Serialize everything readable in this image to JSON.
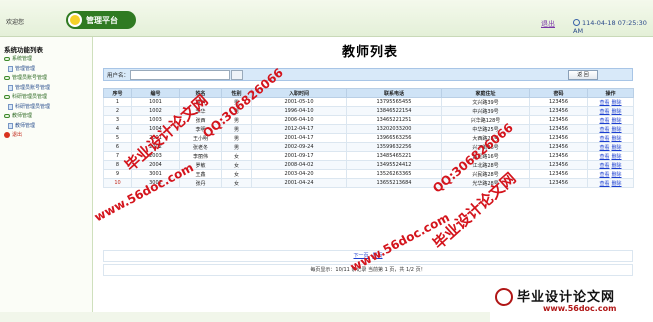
{
  "header": {
    "welcome": "欢迎您",
    "logo_text": "管理平台",
    "logout": "退出",
    "datetime": "114-04-18 07:25:30 AM"
  },
  "sidebar": {
    "title": "系统功能列表",
    "items": [
      {
        "label": "系统管理",
        "level": "top"
      },
      {
        "label": "管理管理",
        "level": "sub"
      },
      {
        "label": "管理员账号管理",
        "level": "top"
      },
      {
        "label": "管理员账号管理",
        "level": "sub"
      },
      {
        "label": "科研管理员管理",
        "level": "top"
      },
      {
        "label": "科研管理员管理",
        "level": "sub"
      },
      {
        "label": "教师管理",
        "level": "top"
      },
      {
        "label": "教师管理",
        "level": "sub"
      },
      {
        "label": "退出",
        "level": "exit"
      }
    ]
  },
  "main": {
    "title": "教师列表",
    "search_label": "用户名：",
    "search_value": "",
    "back_button": "返 回",
    "columns": [
      "序号",
      "编号",
      "姓名",
      "性别",
      "入职时间",
      "联系电话",
      "家庭住址",
      "密码",
      "操作"
    ],
    "rows": [
      [
        "1",
        "1001",
        "胡洪",
        "男",
        "2001-05-10",
        "13795565455",
        "文兴路39号",
        "123456"
      ],
      [
        "2",
        "1002",
        "李华",
        "男",
        "1996-04-10",
        "13846522154",
        "中兴路39号",
        "123456"
      ],
      [
        "3",
        "1003",
        "张西",
        "男",
        "2006-04-10",
        "13465221251",
        "兴华路128号",
        "123456"
      ],
      [
        "4",
        "1004",
        "李明",
        "男",
        "2012-04-17",
        "13202033200",
        "中华路25号",
        "123456"
      ],
      [
        "5",
        "2001",
        "王小明",
        "男",
        "2001-04-17",
        "13966563256",
        "大西路28号",
        "123456"
      ],
      [
        "6",
        "2002",
        "张老冬",
        "男",
        "2002-09-24",
        "13599632256",
        "兴丁街26号",
        "123456"
      ],
      [
        "7",
        "2003",
        "李丽伟",
        "女",
        "2001-09-17",
        "13485465221",
        "昌星路16号",
        "123456"
      ],
      [
        "8",
        "2004",
        "罗敏",
        "女",
        "2008-04-02",
        "13495524412",
        "江北路28号",
        "123456"
      ],
      [
        "9",
        "3001",
        "王鑫",
        "女",
        "2003-04-20",
        "13526263365",
        "兴民路28号",
        "123456"
      ],
      [
        "10",
        "3002",
        "张丹",
        "女",
        "2001-04-24",
        "13655213684",
        "光华路28号",
        "123456"
      ]
    ],
    "op_view": "查看",
    "op_delete": "删除",
    "pager": {
      "next": "下一页",
      "last": "尾页"
    },
    "summary": "每页显示：10/11 条记录 当前第 1 页，共 1/2 页！"
  },
  "watermarks": {
    "site_cn": "毕业设计论文网",
    "url": "www.56doc.com",
    "qq": "QQ:306826066"
  },
  "brand": {
    "title": "毕业设计论文网",
    "url": "www.56doc.com"
  },
  "colors": {
    "accent_green": "#2f7a22",
    "header_blue": "#cfe3f6",
    "watermark_red": "#d4141c",
    "link_blue": "#1c3fd0"
  }
}
